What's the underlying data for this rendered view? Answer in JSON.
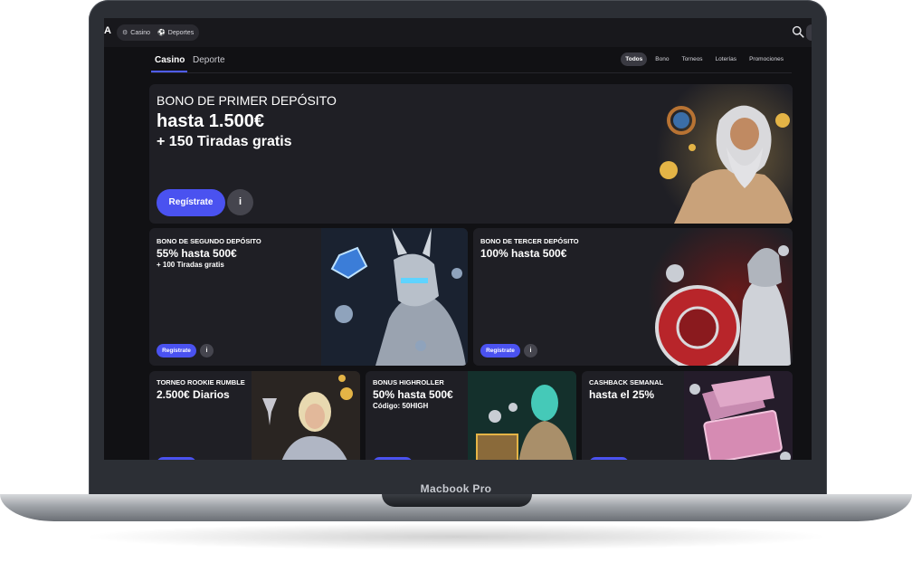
{
  "device": {
    "label": "Macbook Pro"
  },
  "topbar": {
    "logo": "A",
    "nav": [
      {
        "label": "Casino",
        "icon": "gear-icon"
      },
      {
        "label": "Deportes",
        "icon": "ball-icon"
      }
    ]
  },
  "tabs": [
    {
      "label": "Casino",
      "active": true
    },
    {
      "label": "Deporte",
      "active": false
    }
  ],
  "filters": [
    {
      "label": "Todos",
      "active": true
    },
    {
      "label": "Bono"
    },
    {
      "label": "Torneos"
    },
    {
      "label": "Loterías"
    },
    {
      "label": "Promociones"
    }
  ],
  "hero": {
    "kicker": "BONO DE PRIMER DEPÓSITO",
    "line1": "hasta 1.500€",
    "line2": "+ 150 Tiradas gratis",
    "cta": "Regístrate",
    "info_icon": "info-icon"
  },
  "mid_cards": [
    {
      "kicker": "BONO DE SEGUNDO DEPÓSITO",
      "headline": "55% hasta 500€",
      "sub": "+ 100 Tiradas gratis",
      "cta": "Regístrate"
    },
    {
      "kicker": "BONO DE TERCER DEPÓSITO",
      "headline": "100% hasta 500€",
      "sub": "",
      "cta": "Regístrate"
    }
  ],
  "bottom_cards": [
    {
      "kicker": "TORNEO ROOKIE RUMBLE",
      "headline": "2.500€ Diarios",
      "sub": ""
    },
    {
      "kicker": "BONUS HIGHROLLER",
      "headline": "50% hasta 500€",
      "sub": "Código: 50HIGH"
    },
    {
      "kicker": "CASHBACK SEMANAL",
      "headline": "hasta el 25%",
      "sub": ""
    }
  ],
  "colors": {
    "accent": "#4a52f0",
    "screen_bg": "#111114",
    "card_bg": "#1f1f25"
  }
}
